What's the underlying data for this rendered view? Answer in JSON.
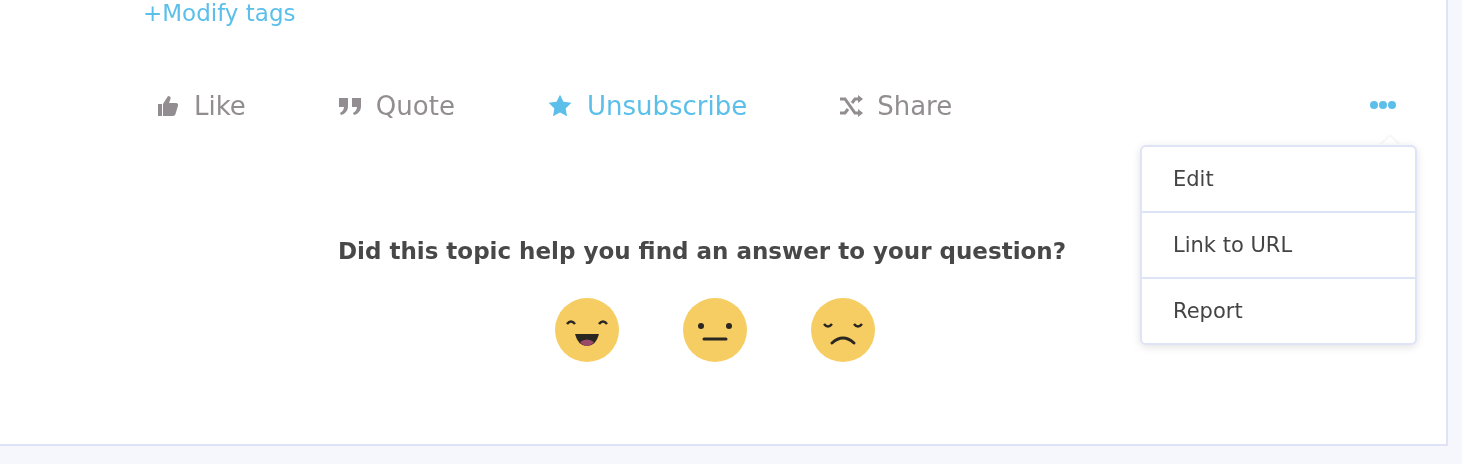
{
  "tags_link": {
    "label": "+Modify tags"
  },
  "actions": [
    {
      "kind": "like",
      "label": "Like",
      "on": false
    },
    {
      "kind": "quote",
      "label": "Quote",
      "on": false
    },
    {
      "kind": "subscribe",
      "label": "Unsubscribe",
      "on": true
    },
    {
      "kind": "share",
      "label": "Share",
      "on": false
    }
  ],
  "more_menu": {
    "expanded": true,
    "items": [
      {
        "label": "Edit"
      },
      {
        "label": "Link to URL"
      },
      {
        "label": "Report"
      }
    ]
  },
  "feedback": {
    "question": "Did this topic help you find an answer to your question?",
    "reactions": [
      {
        "kind": "happy"
      },
      {
        "kind": "neutral"
      },
      {
        "kind": "sad"
      }
    ]
  }
}
